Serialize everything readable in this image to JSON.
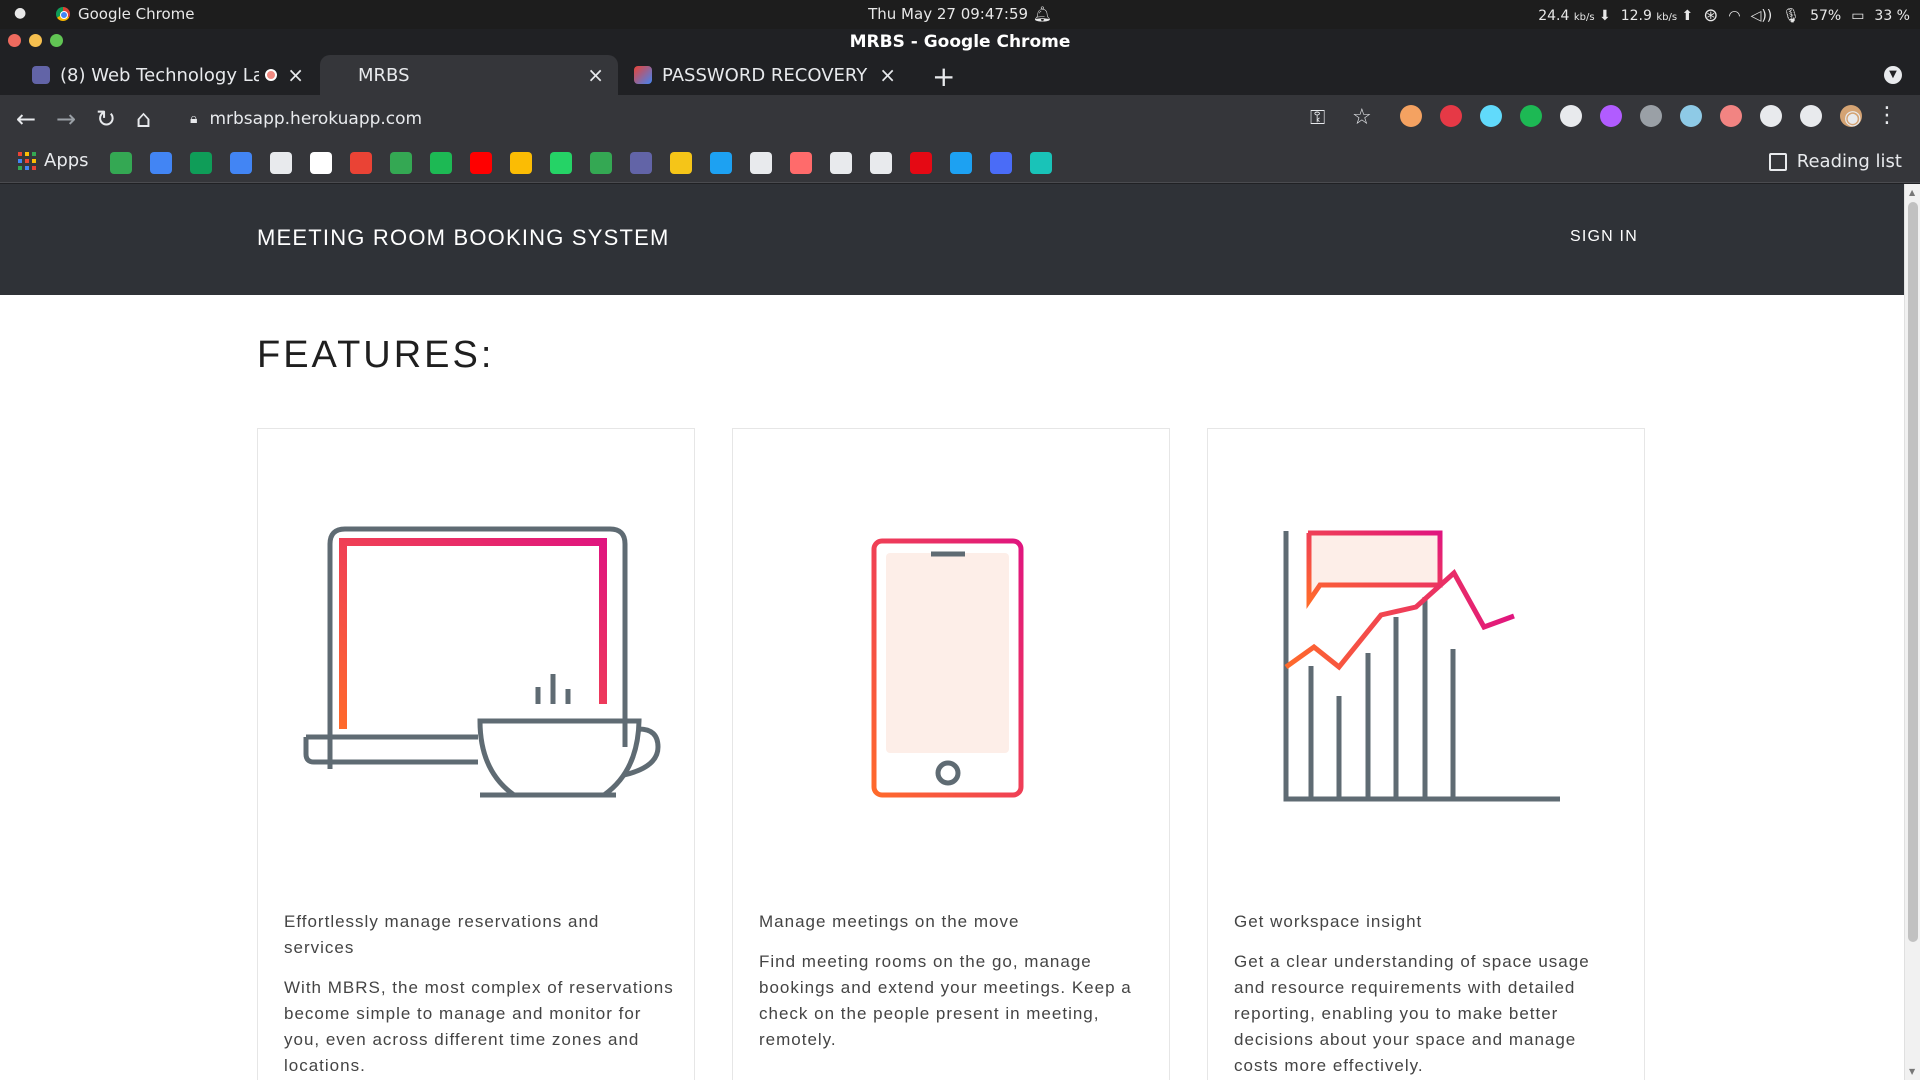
{
  "os_bar": {
    "app_name": "Google Chrome",
    "datetime": "Thu May 27  09:47:59",
    "net_down": "24.4",
    "net_down_unit": "kb/s",
    "net_up": "12.9",
    "net_up_unit": "kb/s",
    "volume": "57%",
    "battery": "33 %"
  },
  "window": {
    "title": "MRBS - Google Chrome"
  },
  "tabs": [
    {
      "label": "(8) Web Technology La",
      "favicon_color": "#6264a7"
    },
    {
      "label": "MRBS",
      "favicon_color": "#35363a"
    },
    {
      "label": "PASSWORD RECOVERY - s",
      "favicon_color": "#ea4335"
    }
  ],
  "toolbar": {
    "url": "mrbsapp.herokuapp.com"
  },
  "bookmarks": {
    "apps_label": "Apps",
    "reading_list_label": "Reading list",
    "icon_colors": [
      "#34a853",
      "#4285f4",
      "#0f9d58",
      "#4285f4",
      "#e8eaed",
      "#ffffff",
      "#ea4335",
      "#34a853",
      "#1db954",
      "#ff0000",
      "#fbbc04",
      "#25d366",
      "#34a853",
      "#6264a7",
      "#f5c518",
      "#1da1f2",
      "#e8eaed",
      "#ff6b6b",
      "#e8eaed",
      "#e8eaed",
      "#e50914",
      "#1da1f2",
      "#4a6cf7",
      "#19c3b8"
    ]
  },
  "extensions": {
    "icon_colors": [
      "#f4a261",
      "#e63946",
      "#61dafb",
      "#1db954",
      "#e8eaed",
      "#b15cff",
      "#9aa0a6",
      "#8ecae6",
      "#f28482",
      "#e8eaed",
      "#e8eaed",
      "#d4a373"
    ]
  },
  "site": {
    "brand": "MEETING ROOM BOOKING SYSTEM",
    "sign_in": "SIGN IN",
    "features_title": "FEATURES:",
    "cards": [
      {
        "heading": "Effortlessly manage reservations and services",
        "description": "With MBRS, the most complex of reservations become simple to manage and monitor for you, even across different time zones and locations."
      },
      {
        "heading": "Manage meetings on the move",
        "description": "Find meeting rooms on the go, manage bookings and extend your meetings. Keep a check on the people present in meeting, remotely."
      },
      {
        "heading": "Get workspace insight",
        "description": "Get a clear understanding of space usage and resource requirements with detailed reporting, enabling you to make better decisions about your space and manage costs more effectively."
      }
    ]
  },
  "colors": {
    "header_bg": "#2f3237",
    "accent_orange": "#ff6a2b",
    "accent_pink": "#e0157f",
    "icon_gray": "#5f6b73"
  }
}
